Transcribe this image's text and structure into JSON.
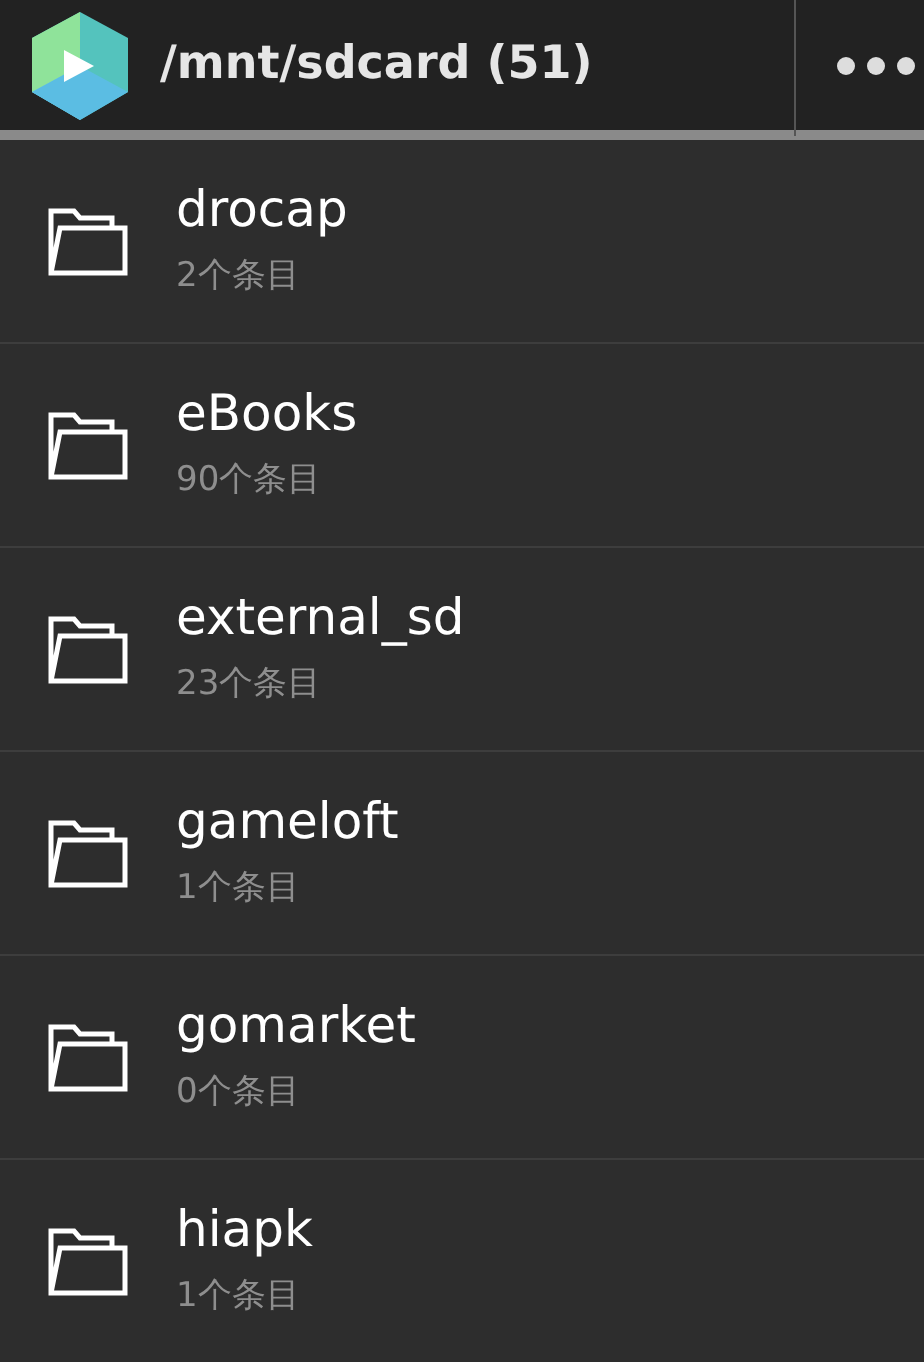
{
  "app_bar": {
    "title": "/mnt/sdcard (51)"
  },
  "items": [
    {
      "name": "drocap",
      "count": "2个条目"
    },
    {
      "name": "eBooks",
      "count": "90个条目"
    },
    {
      "name": "external_sd",
      "count": "23个条目"
    },
    {
      "name": "gameloft",
      "count": "1个条目"
    },
    {
      "name": "gomarket",
      "count": "0个条目"
    },
    {
      "name": "hiapk",
      "count": "1个条目"
    }
  ]
}
